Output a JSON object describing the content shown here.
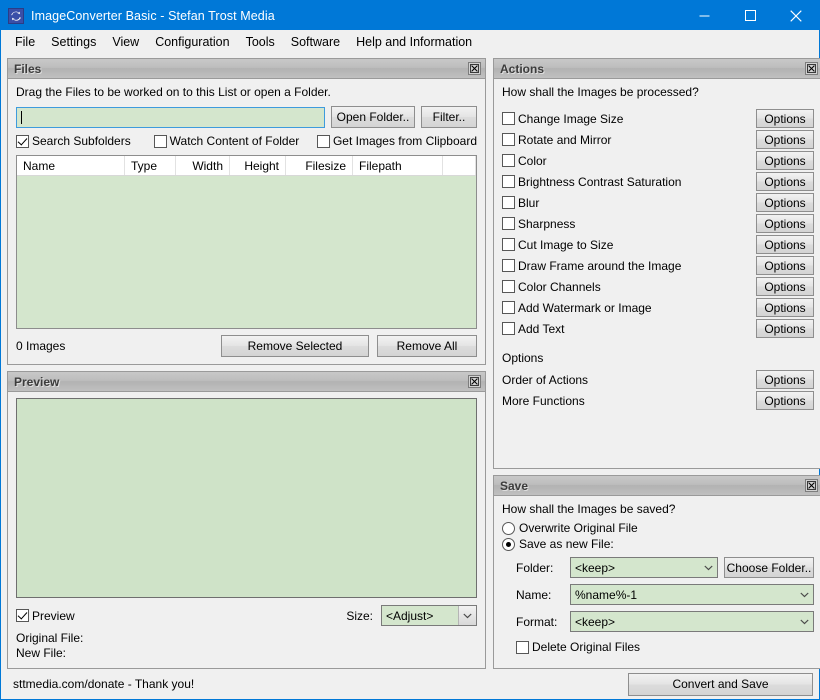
{
  "window": {
    "title": "ImageConverter Basic - Stefan Trost Media",
    "icon": "convert-arrows-icon",
    "accent_color": "#0078d7",
    "field_color": "#d4e6cd",
    "controls": {
      "minimize": "minimize-icon",
      "maximize": "maximize-icon",
      "close": "close-icon"
    }
  },
  "menubar": {
    "items": [
      "File",
      "Settings",
      "View",
      "Configuration",
      "Tools",
      "Software",
      "Help and Information"
    ]
  },
  "files_panel": {
    "title": "Files",
    "close_icon": "panel-close-icon",
    "hint": "Drag the Files to be worked on to this List or open a Folder.",
    "path_input": {
      "value": "",
      "placeholder": ""
    },
    "open_folder_label": "Open Folder..",
    "filter_label": "Filter..",
    "checkboxes": [
      {
        "label": "Search Subfolders",
        "checked": true
      },
      {
        "label": "Watch Content of Folder",
        "checked": false
      },
      {
        "label": "Get Images from Clipboard",
        "checked": false
      }
    ],
    "columns": [
      "Name",
      "Type",
      "Width",
      "Height",
      "Filesize",
      "Filepath"
    ],
    "rows": [],
    "count_label": "0 Images",
    "remove_selected_label": "Remove Selected",
    "remove_all_label": "Remove All"
  },
  "preview_panel": {
    "title": "Preview",
    "close_icon": "panel-close-icon",
    "preview_checkbox": {
      "label": "Preview",
      "checked": true
    },
    "size_label": "Size:",
    "size_value": "<Adjust>",
    "original_file_label": "Original File:",
    "new_file_label": "New File:"
  },
  "actions_panel": {
    "title": "Actions",
    "close_icon": "panel-close-icon",
    "question": "How shall the Images be processed?",
    "options_button_label": "Options",
    "actions": [
      {
        "label": "Change Image Size",
        "checked": false
      },
      {
        "label": "Rotate and Mirror",
        "checked": false
      },
      {
        "label": "Color",
        "checked": false
      },
      {
        "label": "Brightness Contrast Saturation",
        "checked": false
      },
      {
        "label": "Blur",
        "checked": false
      },
      {
        "label": "Sharpness",
        "checked": false
      },
      {
        "label": "Cut Image to Size",
        "checked": false
      },
      {
        "label": "Draw Frame around the Image",
        "checked": false
      },
      {
        "label": "Color Channels",
        "checked": false
      },
      {
        "label": "Add Watermark or Image",
        "checked": false
      },
      {
        "label": "Add Text",
        "checked": false
      }
    ],
    "options_section_title": "Options",
    "option_rows": [
      {
        "label": "Order of Actions"
      },
      {
        "label": "More Functions"
      }
    ]
  },
  "save_panel": {
    "title": "Save",
    "close_icon": "panel-close-icon",
    "question": "How shall the Images be saved?",
    "overwrite_label": "Overwrite Original File",
    "overwrite_selected": false,
    "save_new_label": "Save as new File:",
    "save_new_selected": true,
    "folder_label": "Folder:",
    "folder_value": "<keep>",
    "choose_folder_label": "Choose Folder..",
    "name_label": "Name:",
    "name_value": "%name%-1",
    "format_label": "Format:",
    "format_value": "<keep>",
    "delete_original": {
      "label": "Delete Original Files",
      "checked": false
    }
  },
  "statusbar": {
    "text": "sttmedia.com/donate - Thank you!",
    "convert_label": "Convert and Save"
  }
}
